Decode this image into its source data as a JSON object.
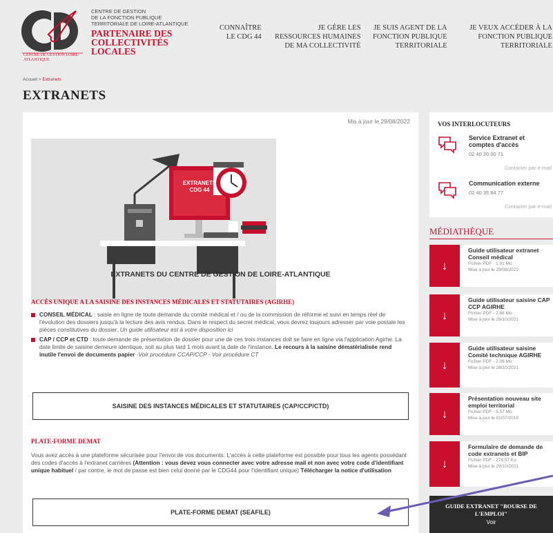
{
  "brand": {
    "logo_caption": "Centre de gestion Loire-Atlantique",
    "org_lines": [
      "CENTRE DE GESTION",
      "DE LA FONCTION PUBLIQUE",
      "TERRITORIALE DE LOIRE-ATLANTIQUE"
    ],
    "tagline": [
      "PARTENAIRE DES",
      "COLLECTIVITÉS",
      "LOCALES"
    ],
    "colors": {
      "accent": "#c8102e",
      "background": "#ececec",
      "dark": "#2b2b2b"
    }
  },
  "nav": [
    {
      "lines": [
        "CONNAÎTRE",
        "LE CDG 44"
      ]
    },
    {
      "lines": [
        "JE GÈRE LES",
        "RESSOURCES HUMAINES",
        "DE MA COLLECTIVITÉ"
      ]
    },
    {
      "lines": [
        "JE SUIS AGENT DE LA",
        "FONCTION PUBLIQUE",
        "TERRITORIALE"
      ]
    },
    {
      "lines": [
        "JE VEUX ACCÉDER À LA",
        "FONCTION PUBLIQUE",
        "TERRITORIALE"
      ]
    }
  ],
  "breadcrumb": {
    "home": "Accueil",
    "sep": ">",
    "current": "Extranets"
  },
  "page": {
    "title": "EXTRANETS",
    "updated": "Mis à jour le 29/08/2022",
    "hero_screen_text": [
      "EXTRANETS",
      "CDG 44"
    ],
    "subtitle": "EXTRANETS DU CENTRE DE GESTION DE LOIRE-ATLANTIQUE"
  },
  "section1": {
    "title": "ACCÈS UNIQUE A LA SAISINE DES INSTANCES MÉDICALES ET STATUTAIRES (AGIRHE)",
    "bullet1": {
      "label": "CONSEIL MÉDICAL",
      "text": " : saisie en ligne de toute demande du comité médical et / ou de la commission de réforme et suivi en temps réel de l'évolution des dossiers jusqu'à la lecture des avis rendus. Dans le respect du secret médical, vous devrez toujours adresser par voie postale les pièces constitutives du dossier. ",
      "italic": "Un guide utilisateur est à votre disposition ici"
    },
    "bullet2": {
      "label": "CAP / CCP et CTD",
      "text": " : toute demande de présentation de dossier pour une de ces trois instances doit se faire en ligne via l'application Agirhe. La date limite de saisine demeure identique, soit au plus tard 1 mois avant la date de l'instance. ",
      "bold": "Le recours à la saisine dématérialisée rend inutile l'envoi de documents papier",
      "italic": " -Voir procédure CCAP/CCP - Voir procédure CT"
    },
    "button": "SAISINE DES INSTANCES MÉDICALES ET STATUTAIRES (CAP/CCP/CTD)"
  },
  "section2": {
    "title": "PLATE-FORME DEMAT",
    "text1": "Vous avez accès à une plateforme sécurisée pour l'envoi de vos documents. L'accès à cette plateforme est possible pour tous les agents possédant des codes d'accès à l'extranet carrières ",
    "bold1": "(Attention : vous devez vous connecter avec votre adresse mail et non avec votre code d'identifiant unique habituel",
    "text2": " / par contre, le mot de passe est bien celui donné par le CDG44 pour l'identifiant unique) ",
    "link": "Télécharger la notice d'utilisation",
    "button": "PLATE-FORME DEMAT (SEAFILE)"
  },
  "sidebar": {
    "contacts_title": "VOS INTERLOCUTEURS",
    "contacts": [
      {
        "name": "Service Extranet et comptes d'accès",
        "phone": "02 40 20 00 71",
        "link": "Contacter par e-mail"
      },
      {
        "name": "Communication externe",
        "phone": "02 40 35 84 77",
        "link": "Contacter par e-mail"
      }
    ],
    "media_title": "MÉDIATHÈQUE",
    "docs": [
      {
        "name": "Guide utilisateur extranet Conseil médical",
        "meta1": "Fichier PDF - 1.91 Mo",
        "meta2": "Mise à jour le 29/08/2022"
      },
      {
        "name": "Guide utilisateur saisine CAP CCP AGIRHE",
        "meta1": "Fichier PDF - 2.88 Mo",
        "meta2": "Mise à jour le 28/10/2021"
      },
      {
        "name": "Guide utilisateur saisine Comité technique AGIRHE",
        "meta1": "Fichier PDF - 2.06 Mo",
        "meta2": "Mise à jour le 28/10/2021"
      },
      {
        "name": "Présentation nouveau site emploi territorial",
        "meta1": "Fichier PDF - 5.37 Mo",
        "meta2": "Mise à jour le 01/07/2019"
      },
      {
        "name": "Formulaire de demande de code extranets et BIP",
        "meta1": "Fichier PDF - 278.57 Ko",
        "meta2": "Mise à jour le 29/10/2021"
      }
    ],
    "guide": {
      "title": "GUIDE EXTRANET \"BOURSE DE L'EMPLOI\"",
      "sub": "Voir"
    }
  },
  "annotation": {
    "color": "#6b5bb5"
  }
}
